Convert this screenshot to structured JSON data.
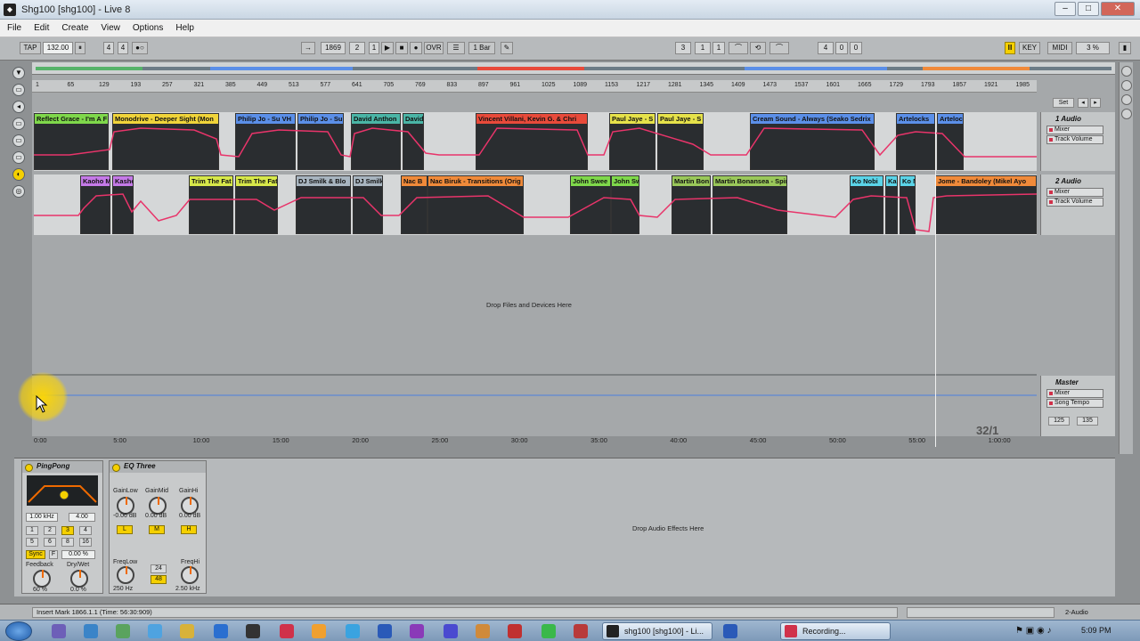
{
  "window": {
    "title": "Shg100  [shg100] - Live 8",
    "app_icon": "ableton-live-icon",
    "controls": [
      "minimize-icon",
      "maximize-icon",
      "close-icon"
    ]
  },
  "menu": [
    "File",
    "Edit",
    "Create",
    "View",
    "Options",
    "Help"
  ],
  "transport": {
    "tap": "TAP",
    "tempo": "132.00",
    "meter_num": "4",
    "meter_den": "4",
    "position": [
      "1869",
      "2",
      "1"
    ],
    "ovr": "OVR",
    "quantize": "1 Bar",
    "loop_start": [
      "3",
      "1",
      "1"
    ],
    "loop_length": [
      "4",
      "0",
      "0"
    ],
    "key": "KEY",
    "midi": "MIDI",
    "cpu": "3 %"
  },
  "ruler": {
    "marks": [
      "1",
      "65",
      "129",
      "193",
      "257",
      "321",
      "385",
      "449",
      "513",
      "577",
      "641",
      "705",
      "769",
      "833",
      "897",
      "961",
      "1025",
      "1089",
      "1153",
      "1217",
      "1281",
      "1345",
      "1409",
      "1473",
      "1537",
      "1601",
      "1665",
      "1729",
      "1793",
      "1857",
      "1921",
      "1985"
    ],
    "set_label": "Set"
  },
  "tracks": [
    {
      "name": "1 Audio",
      "device": "Mixer",
      "param": "Track Volume",
      "clips": [
        {
          "name": "Reflect Grace - I'm A F",
          "color": "#7fd84b"
        },
        {
          "name": "Monodrive - Deeper Sight (Mon",
          "color": "#f0d43a"
        },
        {
          "name": "Philip Jo - Su VH",
          "color": "#5b8fe8"
        },
        {
          "name": "Philip Jo - Su",
          "color": "#5b8fe8"
        },
        {
          "name": "David  Anthon",
          "color": "#4ab5a6"
        },
        {
          "name": "David ",
          "color": "#4ab5a6"
        },
        {
          "name": "Vincent Villani, Kevin G. & Chri",
          "color": "#e84a3a"
        },
        {
          "name": "Paul Jaye - S",
          "color": "#e6e24a"
        },
        {
          "name": "Paul Jaye - S",
          "color": "#e6e24a"
        },
        {
          "name": "Cream Sound - Always (Seako Sedrix",
          "color": "#5b8fe8"
        },
        {
          "name": "Artelocks",
          "color": "#5b8fe8"
        },
        {
          "name": "Artelock",
          "color": "#5b8fe8"
        }
      ]
    },
    {
      "name": "2 Audio",
      "device": "Mixer",
      "param": "Track Volume",
      "clips": [
        {
          "name": "Kaoho M",
          "color": "#c57ae8"
        },
        {
          "name": "Kasho",
          "color": "#c57ae8"
        },
        {
          "name": "Trim The Fat",
          "color": "#d7e84a"
        },
        {
          "name": "Trim The Fat",
          "color": "#d7e84a"
        },
        {
          "name": "DJ Smilk & Blo",
          "color": "#a8b5c0"
        },
        {
          "name": "DJ Smilk",
          "color": "#a8b5c0"
        },
        {
          "name": "Nac B",
          "color": "#f08a3a"
        },
        {
          "name": "Nac Biruk - Transitions (Orig",
          "color": "#f08a3a"
        },
        {
          "name": "John Swee",
          "color": "#7fd84b"
        },
        {
          "name": "John Sw",
          "color": "#7fd84b"
        },
        {
          "name": "Martin Bon",
          "color": "#9ac85a"
        },
        {
          "name": "Martin Bonansea - Spir",
          "color": "#9ac85a"
        },
        {
          "name": "Ko Nobi",
          "color": "#5bd4e8"
        },
        {
          "name": "Ka",
          "color": "#5bd4e8"
        },
        {
          "name": "Ko N",
          "color": "#5bd4e8"
        },
        {
          "name": "Jome - Bandoley (Mikel Ayo",
          "color": "#f08a3a"
        }
      ]
    }
  ],
  "drop_text": "Drop Files and Devices Here",
  "master": {
    "name": "Master",
    "device": "Mixer",
    "param": "Song Tempo",
    "tempo_min": "125",
    "tempo_max": "135"
  },
  "time_axis": [
    "0:00",
    "5:00",
    "10:00",
    "15:00",
    "20:00",
    "25:00",
    "30:00",
    "35:00",
    "40:00",
    "45:00",
    "50:00",
    "55:00",
    "1:00:00"
  ],
  "bar_counter": "32/1",
  "devices": {
    "pingpong": {
      "title": "PingPong",
      "freq": "1.00 kHz",
      "q": "4.00",
      "delay_beats": [
        "1",
        "2",
        "3",
        "4",
        "5",
        "6",
        "8",
        "16"
      ],
      "sync": "Sync",
      "f_btn": "F",
      "offset": "0.00 %",
      "feedback_label": "Feedback",
      "feedback_value": "60 %",
      "drywet_label": "Dry/Wet",
      "drywet_value": "0.0 %"
    },
    "eqthree": {
      "title": "EQ Three",
      "gainlow_label": "GainLow",
      "gainmid_label": "GainMid",
      "gainhi_label": "GainHi",
      "gainlow_value": "-0.06 dB",
      "gainmid_value": "0.00 dB",
      "gainhi_value": "0.00 dB",
      "l": "L",
      "m": "M",
      "h": "H",
      "freqlow_label": "FreqLow",
      "freqhi_label": "FreqHi",
      "freqlow_value": "250 Hz",
      "freqhi_value": "2.50 kHz",
      "slope_24": "24",
      "slope_48": "48"
    },
    "drop_fx": "Drop Audio Effects Here"
  },
  "status": {
    "text": "Insert Mark 1866.1.1 (Time: 56:30:909)",
    "track_label": "2-Audio"
  },
  "taskbar": {
    "tasks": [
      {
        "label": "shg100 [shg100] - Li...",
        "icon": "ableton-live-icon"
      },
      {
        "label": "Recording...",
        "icon": "recorder-icon"
      }
    ],
    "clock": "5:09 PM"
  }
}
